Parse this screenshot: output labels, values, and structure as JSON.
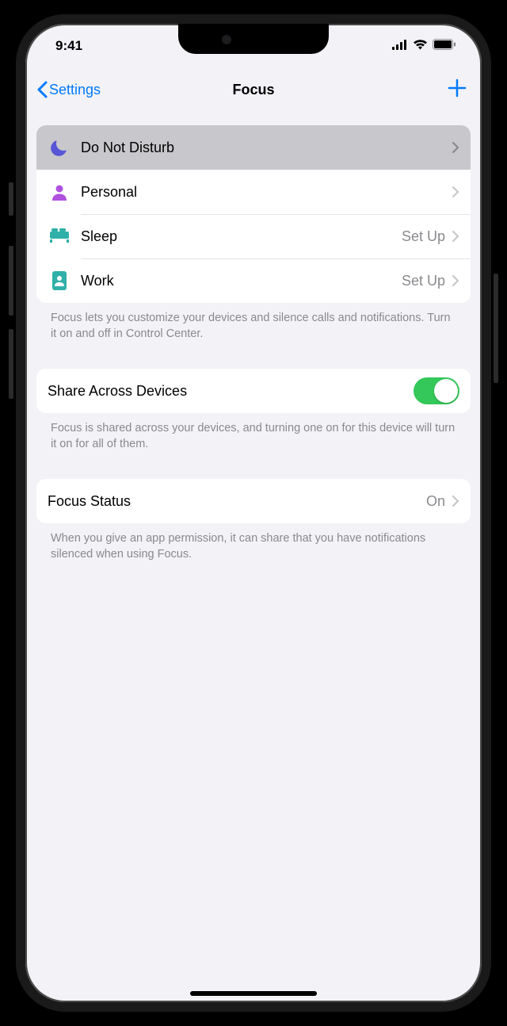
{
  "status": {
    "time": "9:41"
  },
  "nav": {
    "back_label": "Settings",
    "title": "Focus"
  },
  "focus_modes": [
    {
      "label": "Do Not Disturb",
      "detail": "",
      "highlight": true,
      "icon": "moon",
      "color": "#5856d6"
    },
    {
      "label": "Personal",
      "detail": "",
      "highlight": false,
      "icon": "person",
      "color": "#af52de"
    },
    {
      "label": "Sleep",
      "detail": "Set Up",
      "highlight": false,
      "icon": "bed",
      "color": "#30b0a8"
    },
    {
      "label": "Work",
      "detail": "Set Up",
      "highlight": false,
      "icon": "badge",
      "color": "#30b0a8"
    }
  ],
  "footers": {
    "modes": "Focus lets you customize your devices and silence calls and notifications. Turn it on and off in Control Center.",
    "share": "Focus is shared across your devices, and turning one on for this device will turn it on for all of them.",
    "status": "When you give an app permission, it can share that you have notifications silenced when using Focus."
  },
  "share": {
    "label": "Share Across Devices",
    "on": true
  },
  "focus_status": {
    "label": "Focus Status",
    "value": "On"
  }
}
